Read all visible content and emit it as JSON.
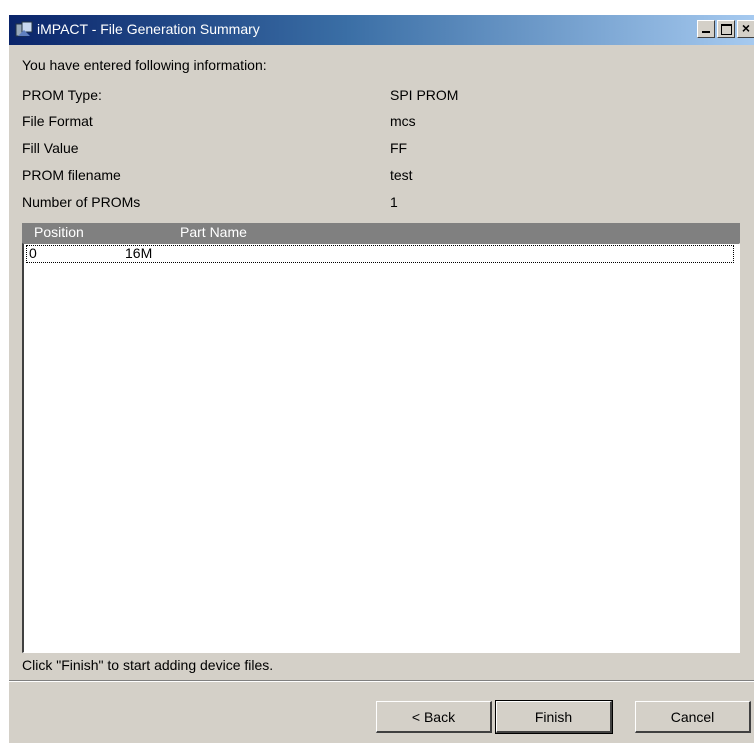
{
  "window": {
    "title": "iMPACT - File Generation Summary",
    "controls": {
      "minimize": "minimize-icon",
      "maximize": "maximize-icon",
      "close": "×"
    }
  },
  "summary": {
    "heading": "You have entered following information:",
    "fields": [
      {
        "label": "PROM Type:",
        "value": "SPI PROM"
      },
      {
        "label": "File Format",
        "value": "mcs"
      },
      {
        "label": "Fill Value",
        "value": "FF"
      },
      {
        "label": "PROM filename",
        "value": "test"
      },
      {
        "label": "Number of PROMs",
        "value": "1"
      }
    ]
  },
  "table": {
    "columns": [
      "Position",
      "Part Name"
    ],
    "rows": [
      {
        "position": "0",
        "part_name": "16M"
      }
    ]
  },
  "footer": {
    "hint": "Click \"Finish\" to start adding device files."
  },
  "buttons": {
    "back_label": "< Back",
    "finish_label": "Finish",
    "cancel_label": "Cancel"
  },
  "colors": {
    "titlebar_start": "#0a246a",
    "titlebar_end": "#a6caf0",
    "dialog_bg": "#d4d0c8",
    "header_bg": "#808080"
  }
}
